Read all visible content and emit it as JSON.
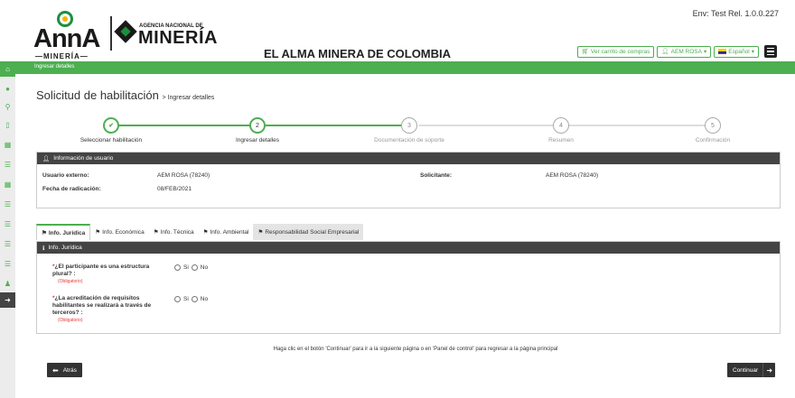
{
  "header": {
    "anna_word": "AnnA",
    "anna_sub": "—MINERÍA—",
    "agency_small": "AGENCIA NACIONAL DE",
    "agency_big": "MINERÍA",
    "site_title": "EL ALMA MINERA DE COLOMBIA",
    "env": "Env: Test Rel. 1.0.0.227",
    "cart_label": "Ver carrito de compras",
    "user_label": "AEM ROSA",
    "lang_label": "Español"
  },
  "nav": {
    "current": "Ingresar detalles"
  },
  "page": {
    "title": "Solicitud de habilitación",
    "breadcrumb": "> Ingresar detalles"
  },
  "stepper": {
    "steps": [
      {
        "number": "✔",
        "label": "Seleccionar habilitación",
        "state": "done"
      },
      {
        "number": "2",
        "label": "Ingresar detalles",
        "state": "active"
      },
      {
        "number": "3",
        "label": "Documentación de soporte",
        "state": "idle"
      },
      {
        "number": "4",
        "label": "Resumen",
        "state": "idle"
      },
      {
        "number": "5",
        "label": "Confirmación",
        "state": "idle"
      }
    ]
  },
  "user_info": {
    "heading": "Información de usuario",
    "external_user_label": "Usuario externo:",
    "external_user_value": "AEM ROSA (78240)",
    "applicant_label": "Solicitante:",
    "applicant_value": "AEM ROSA (78240)",
    "date_label": "Fecha de radicación:",
    "date_value": "08/FEB/2021"
  },
  "tabs": [
    {
      "label": "Info. Jurídica"
    },
    {
      "label": "Info. Económica"
    },
    {
      "label": "Info. Técnica"
    },
    {
      "label": "Info. Ambiental"
    },
    {
      "label": "Responsabilidad Social Empresarial"
    }
  ],
  "legal": {
    "heading": "Info. Jurídica",
    "q1": "¿El participante es una estructura plural? :",
    "q2": "¿La acreditación de requisitos habilitantes se realizará a través de terceros? :",
    "required": "(Obligatorio)",
    "yes": "Si",
    "no": "No"
  },
  "footer": {
    "note": "Haga clic en el botón 'Continuar' para ir a la siguiente página o en 'Panel de control' para regresar a la página principal",
    "back": "Atrás",
    "continue": "Continuar"
  },
  "colors": {
    "brand_green": "#4caf50",
    "dark_header": "#444444",
    "required_red": "#e53935"
  }
}
